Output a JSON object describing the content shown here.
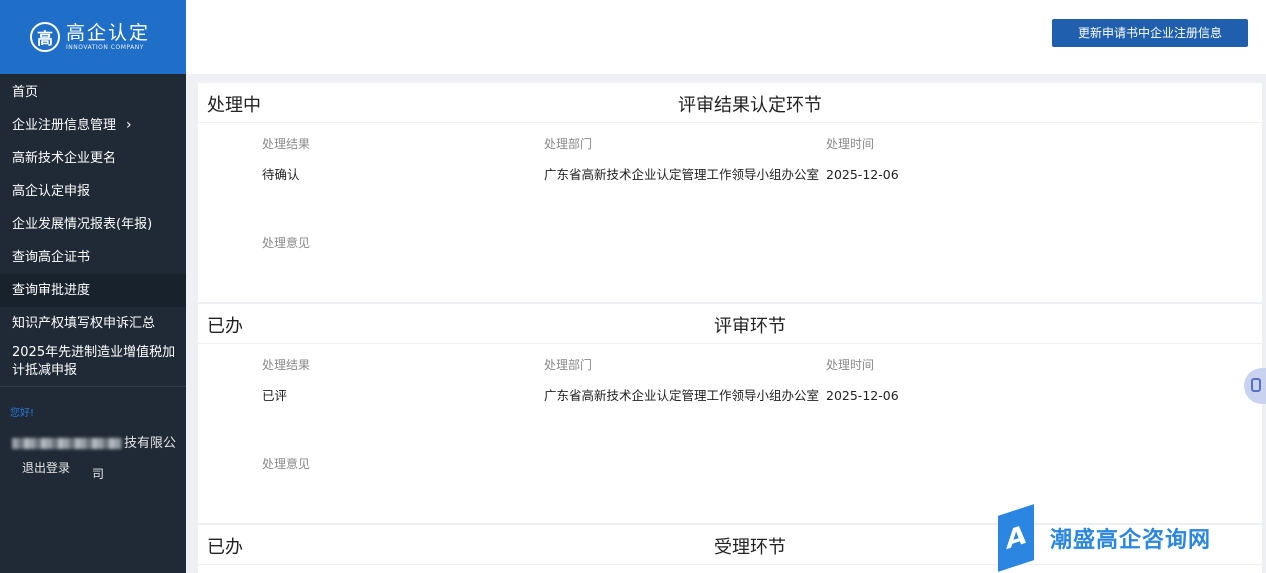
{
  "logo": {
    "title": "高企认定",
    "subtitle": "INNOVATION COMPANY",
    "mark": "高"
  },
  "sidebar": {
    "items": [
      {
        "label": "首页"
      },
      {
        "label": "企业注册信息管理",
        "chevron": "›"
      },
      {
        "label": "高新技术企业更名"
      },
      {
        "label": "高企认定申报"
      },
      {
        "label": "企业发展情况报表(年报)"
      },
      {
        "label": "查询高企证书"
      },
      {
        "label": "查询审批进度"
      },
      {
        "label": "知识产权填写权申诉汇总"
      },
      {
        "label": "2025年先进制造业增值税加计抵减申报"
      }
    ],
    "greeting": "您好!",
    "company_visible": "技有限公",
    "company_tail": "司",
    "logout": "退出登录"
  },
  "header": {
    "update_button": "更新申请书中企业注册信息"
  },
  "panels": [
    {
      "status": "处理中",
      "stage": "评审结果认定环节",
      "labels": {
        "result": "处理结果",
        "dept": "处理部门",
        "time": "处理时间",
        "opinion": "处理意见"
      },
      "result": "待确认",
      "dept": "广东省高新技术企业认定管理工作领导小组办公室",
      "time": "2025-12-06"
    },
    {
      "status": "已办",
      "stage": "评审环节",
      "labels": {
        "result": "处理结果",
        "dept": "处理部门",
        "time": "处理时间",
        "opinion": "处理意见"
      },
      "result": "已评",
      "dept": "广东省高新技术企业认定管理工作领导小组办公室",
      "time": "2025-12-06"
    },
    {
      "status": "已办",
      "stage": "受理环节"
    }
  ],
  "watermark": {
    "text": "潮盛高企咨询网",
    "letter": "A"
  },
  "colors": {
    "sidebar": "#1f2a36",
    "logo_bg": "#1f6fc8",
    "primary_button": "#1f5fae",
    "watermark": "#2a86e0"
  },
  "icons": {
    "float_button": "document-icon"
  }
}
